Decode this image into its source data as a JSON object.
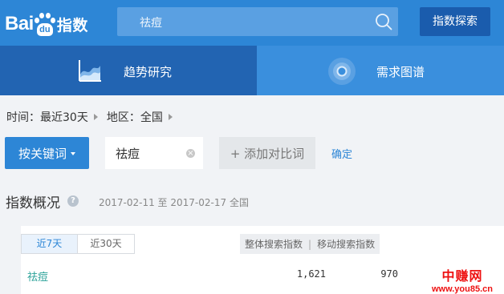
{
  "header": {
    "logo_bai": "Bai",
    "logo_du": "du",
    "logo_zhishu": "指数",
    "search_value": "祛痘",
    "explore_label": "指数探索"
  },
  "tabs": [
    {
      "label": "趋势研究",
      "icon": "trend-chart-icon",
      "active": true
    },
    {
      "label": "需求图谱",
      "icon": "radar-icon",
      "active": false
    }
  ],
  "filters": {
    "time": "时间：最近30天",
    "region": "地区：全国"
  },
  "keyword_bar": {
    "button_label": "按关键词",
    "keyword": "祛痘",
    "remove_icon": "×",
    "add_compare": "+ 添加对比词",
    "confirm": "确定"
  },
  "overview": {
    "title": "指数概况",
    "help_icon": "?",
    "date_range": "2017-02-11 至 2017-02-17",
    "region": "全国",
    "periods": [
      "近7天",
      "近30天"
    ],
    "columns": [
      "整体搜索指数",
      "移动搜索指数"
    ],
    "row": {
      "keyword": "祛痘",
      "total": "1,621",
      "mobile": "970"
    }
  },
  "watermark": {
    "cn": "中赚网",
    "url": "www.you85.cn"
  },
  "colors": {
    "header": "#2d86d6",
    "tab_active": "#2264b2",
    "accent": "#2d86d6",
    "keyword_link": "#2aa198"
  }
}
